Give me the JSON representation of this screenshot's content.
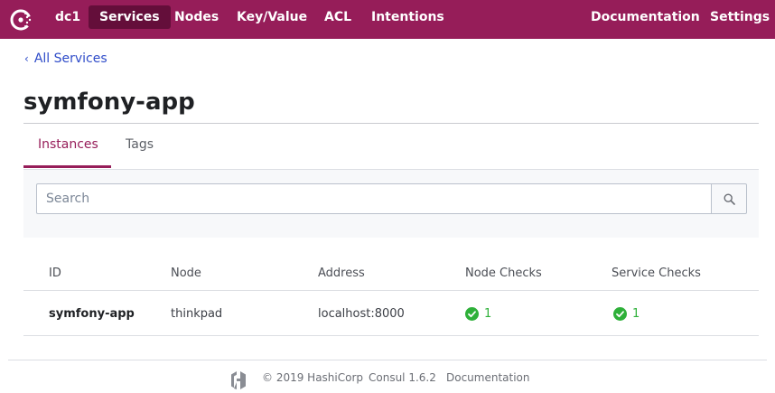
{
  "header": {
    "logo_icon": "consul-logo-icon",
    "datacenter": "dc1",
    "nav": {
      "services": "Services",
      "nodes": "Nodes",
      "keyvalue": "Key/Value",
      "acl": "ACL",
      "intentions": "Intentions",
      "documentation": "Documentation",
      "settings": "Settings"
    },
    "active_item": "Services",
    "brand_color": "#961d59",
    "active_color": "#640e3a"
  },
  "breadcrumb": {
    "label": "All Services",
    "icon": "chevron-left-icon"
  },
  "page": {
    "title": "symfony-app"
  },
  "tabs": {
    "instances": "Instances",
    "tags": "Tags",
    "active": "Instances"
  },
  "search": {
    "placeholder": "Search",
    "value": "",
    "icon": "search-icon"
  },
  "table": {
    "headers": {
      "id": "ID",
      "node": "Node",
      "address": "Address",
      "node_checks": "Node Checks",
      "service_checks": "Service Checks"
    },
    "rows": [
      {
        "id": "symfony-app",
        "node": "thinkpad",
        "address": "localhost:8000",
        "node_checks": "1",
        "service_checks": "1",
        "check_icon": "check-circle-icon"
      }
    ]
  },
  "footer": {
    "logo_icon": "hashicorp-logo-icon",
    "copyright": "© 2019 HashiCorp",
    "version": "Consul 1.6.2",
    "docs": "Documentation"
  },
  "colors": {
    "link": "#2f4cc9",
    "passing": "#2eb039"
  }
}
